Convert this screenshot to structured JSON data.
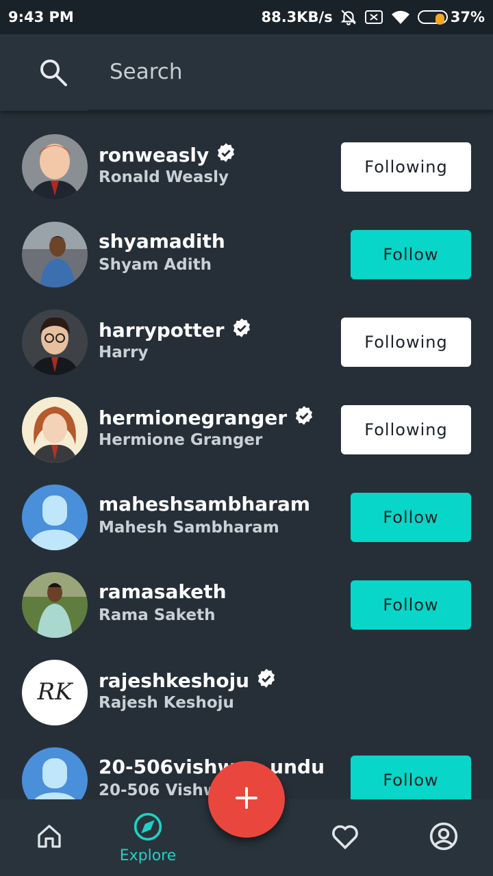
{
  "status_bar": {
    "time": "9:43 PM",
    "network_speed": "88.3KB/s",
    "battery_percent": "37%",
    "battery_level": 0.37
  },
  "search": {
    "placeholder": "Search"
  },
  "users": [
    {
      "username": "ronweasly",
      "full_name": "Ronald Weasly",
      "verified": true,
      "button": "Following"
    },
    {
      "username": "shyamadith",
      "full_name": "Shyam Adith",
      "verified": false,
      "button": "Follow"
    },
    {
      "username": "harrypotter",
      "full_name": "Harry",
      "verified": true,
      "button": "Following"
    },
    {
      "username": "hermionegranger",
      "full_name": "Hermione Granger",
      "verified": true,
      "button": "Following"
    },
    {
      "username": "maheshsambharam",
      "full_name": "Mahesh Sambharam",
      "verified": false,
      "button": "Follow"
    },
    {
      "username": "ramasaketh",
      "full_name": "Rama Saketh",
      "verified": false,
      "button": "Follow"
    },
    {
      "username": "rajeshkeshoju",
      "full_name": "Rajesh Keshoju",
      "verified": true,
      "button": ""
    },
    {
      "username": "20-506vishwa...undu",
      "full_name": "20-506 Vishw...u",
      "verified": false,
      "button": "Follow"
    }
  ],
  "avatar_logo_text": "RK",
  "nav": {
    "explore_label": "Explore"
  },
  "colors": {
    "accent": "#07d6c8",
    "fab": "#e9473e",
    "background": "#262f38"
  }
}
